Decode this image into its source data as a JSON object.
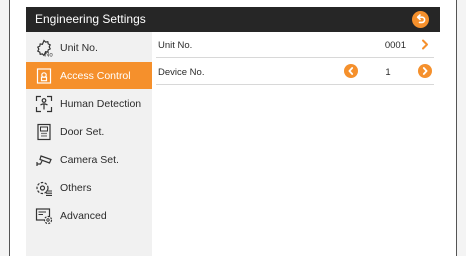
{
  "window": {
    "title": "Engineering Settings"
  },
  "sidebar": {
    "items": [
      {
        "label": "Unit No.",
        "icon": "unit-no-icon",
        "active": false
      },
      {
        "label": "Access Control",
        "icon": "access-control-icon",
        "active": true
      },
      {
        "label": "Human Detection",
        "icon": "human-detection-icon",
        "active": false
      },
      {
        "label": "Door Set.",
        "icon": "door-icon",
        "active": false
      },
      {
        "label": "Camera Set.",
        "icon": "camera-icon",
        "active": false
      },
      {
        "label": "Others",
        "icon": "gear-list-icon",
        "active": false
      },
      {
        "label": "Advanced",
        "icon": "advanced-settings-icon",
        "active": false
      }
    ]
  },
  "main": {
    "unit_no": {
      "label": "Unit No.",
      "value": "0001"
    },
    "device_no": {
      "label": "Device No.",
      "value": "1"
    }
  },
  "colors": {
    "accent": "#f5902c",
    "titlebar": "#262626",
    "sidebar_bg": "#f1f1f1"
  }
}
